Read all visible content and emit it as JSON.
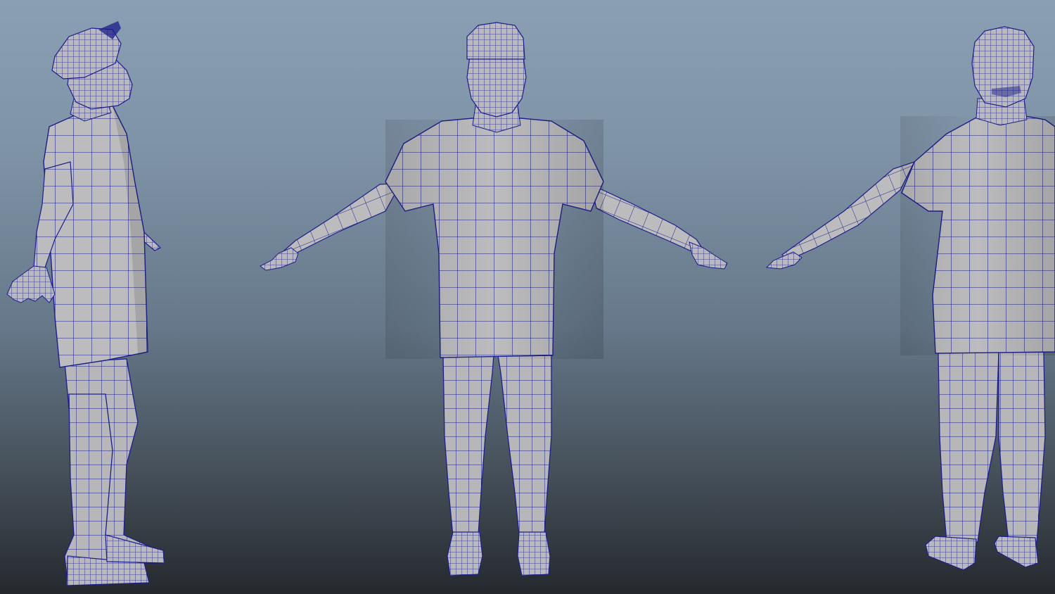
{
  "viewport": {
    "camera_label": "",
    "background_top": "#8a9fb4",
    "background_bottom": "#25292e",
    "mesh_fill": "#bdbdbf",
    "mesh_shade": "#8e8e92",
    "wireframe_color": "#1c1e8a"
  },
  "models": [
    {
      "view": "side",
      "name": "character-side-view"
    },
    {
      "view": "front",
      "name": "character-front-view"
    },
    {
      "view": "back",
      "name": "character-back-view"
    }
  ]
}
